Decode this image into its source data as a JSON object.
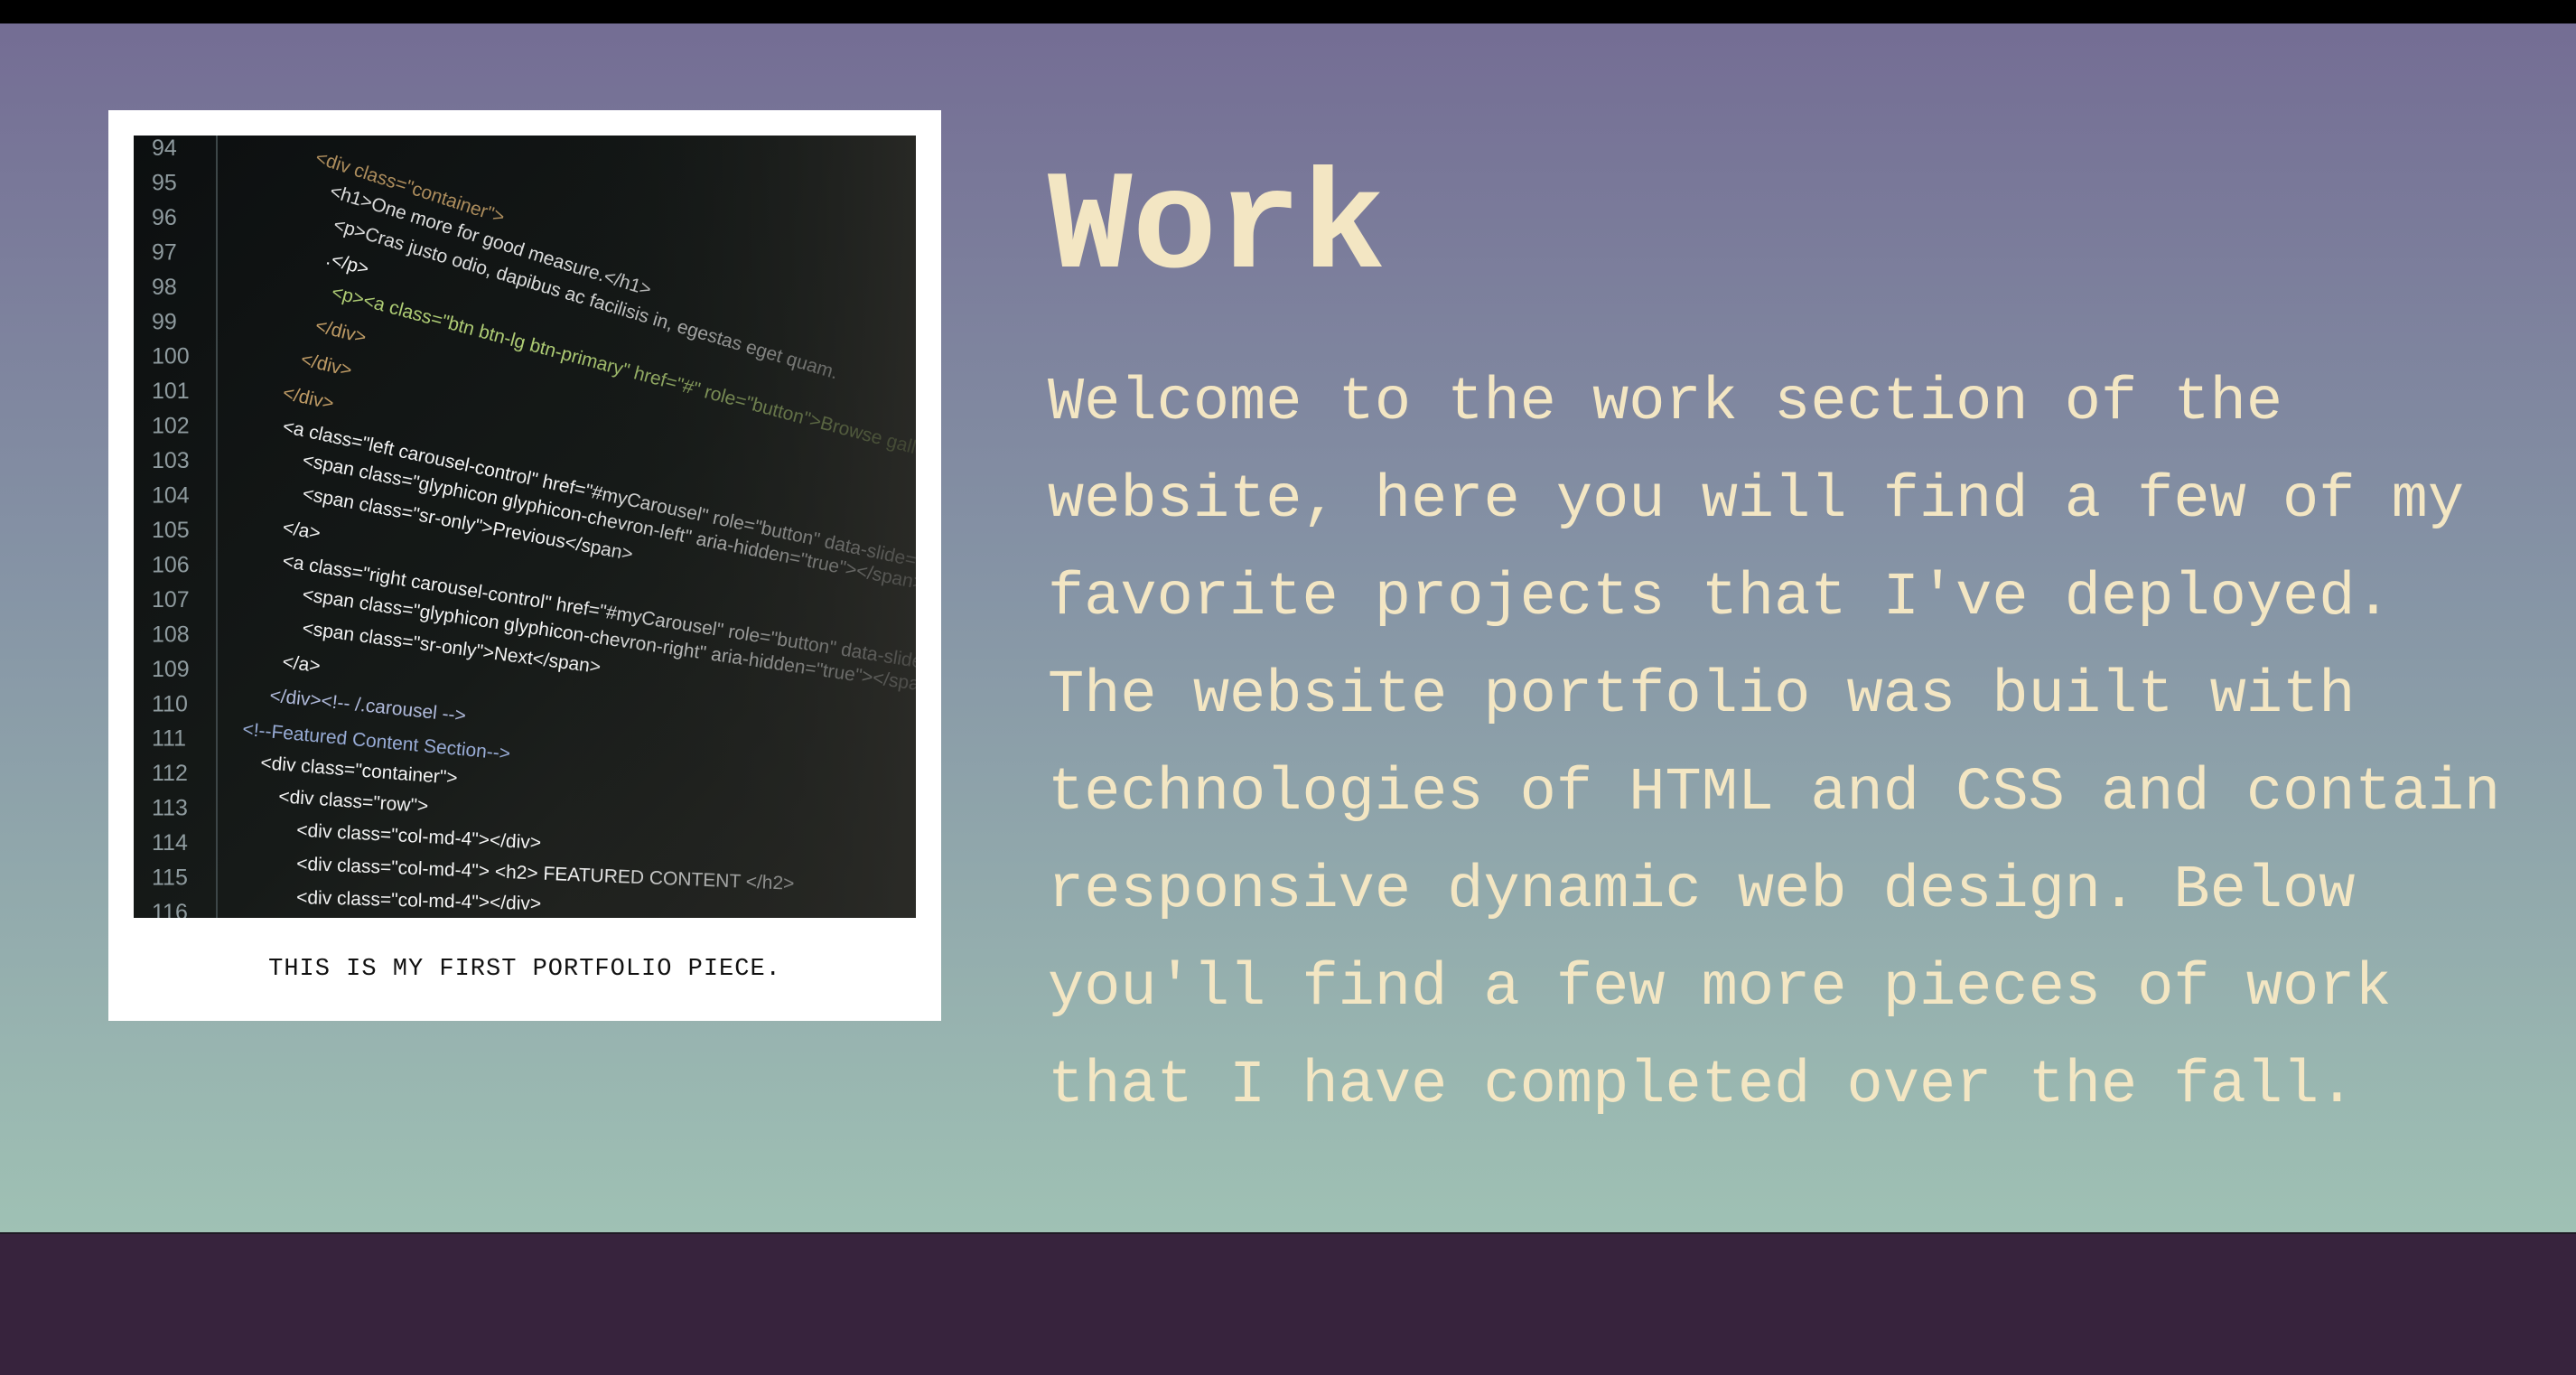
{
  "work": {
    "heading": "Work",
    "intro": "Welcome to the work section of the website, here you will find a few of my favorite projects that I've deployed. The website portfolio was built with technologies of HTML and CSS and contain responsive dynamic web design. Below you'll find a few more pieces of work that I have completed over the fall.",
    "portfolio_caption": "THIS IS MY FIRST PORTFOLIO PIECE."
  },
  "code_photo": {
    "line_numbers": [
      "94",
      "95",
      "96",
      "97",
      "98",
      "99",
      "100",
      "101",
      "102",
      "103",
      "104",
      "105",
      "106",
      "107",
      "108",
      "109",
      "110",
      "111",
      "112",
      "113",
      "114",
      "115",
      "116"
    ],
    "code_lines": [
      "<div class=\"container\">",
      "<h1>One more for good measure.</h1>",
      "<p>Cras justo odio, dapibus ac facilisis in, egestas eget quam.",
      ".</p>",
      "<p><a class=\"btn btn-lg btn-primary\" href=\"#\" role=\"button\">Browse gallery</a>",
      "</div>",
      "</div>",
      "</div>",
      "<a class=\"left carousel-control\" href=\"#myCarousel\" role=\"button\" data-slide=\"prev\">",
      "<span class=\"glyphicon glyphicon-chevron-left\" aria-hidden=\"true\"></span>",
      "<span class=\"sr-only\">Previous</span>",
      "</a>",
      "<a class=\"right carousel-control\" href=\"#myCarousel\" role=\"button\" data-slide=\"next\">",
      "<span class=\"glyphicon glyphicon-chevron-right\" aria-hidden=\"true\"></span>",
      "<span class=\"sr-only\">Next</span>",
      "</a>",
      "</div><!-- /.carousel -->",
      "<!--Featured Content Section-->",
      "<div class=\"container\">",
      "<div class=\"row\">",
      "<div class=\"col-md-4\"></div>",
      "<div class=\"col-md-4\"> <h2> FEATURED CONTENT </h2>",
      "<div class=\"col-md-4\"></div>"
    ]
  },
  "colors": {
    "top_bar": "#000000",
    "gradient_top": "#746d94",
    "gradient_bottom": "#9fc1b4",
    "footer": "#37233d",
    "text_cream": "#f3e6c3"
  }
}
